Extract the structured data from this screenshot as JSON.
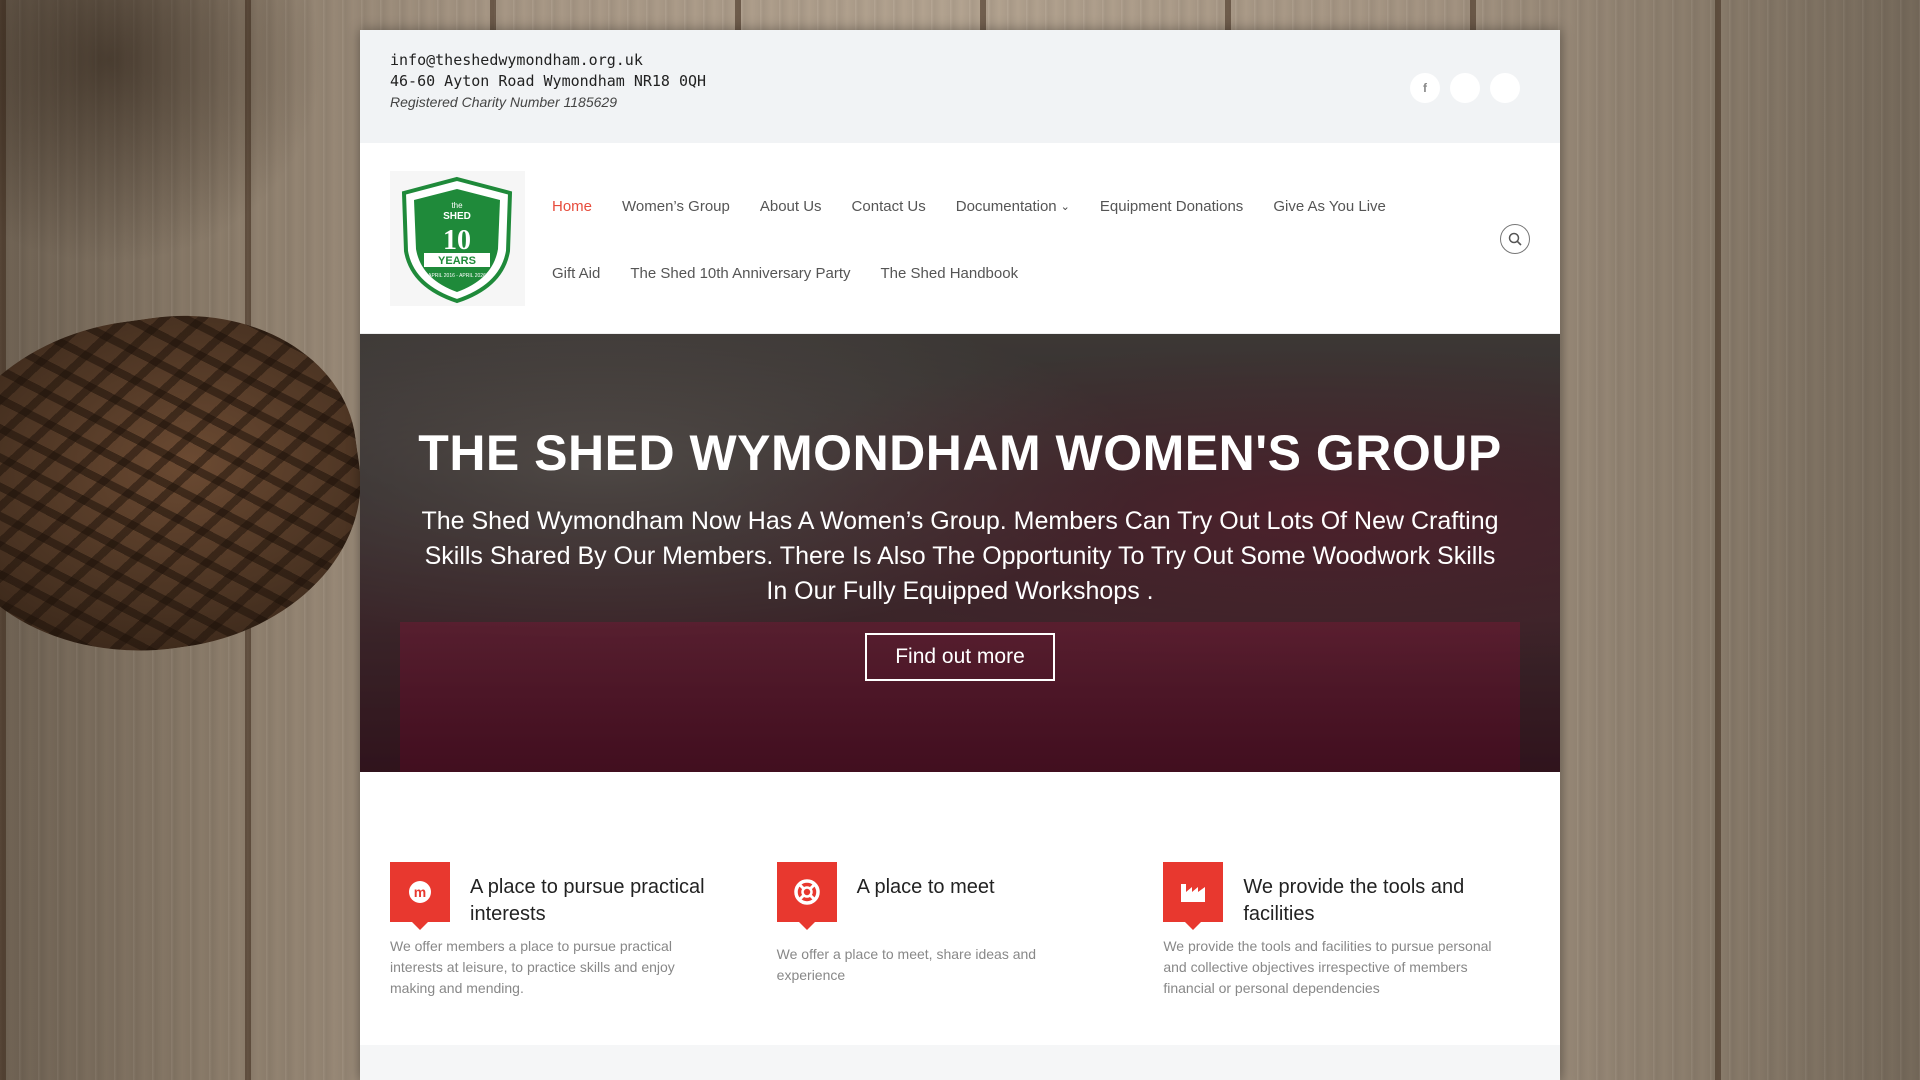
{
  "topbar": {
    "email": "info@theshedwymondham.org.uk",
    "address": "46-60 Ayton Road Wymondham NR18 0QH",
    "charity": "Registered Charity Number 1185629",
    "social_icons": [
      "facebook-icon",
      "social-icon-2",
      "social-icon-3"
    ],
    "facebook_glyph": "f"
  },
  "logo": {
    "line1": "the",
    "line2": "SHED",
    "number": "10",
    "years": "YEARS",
    "dates": "APRIL 2016 - APRIL 2026",
    "color": "#1f8a3a"
  },
  "nav": {
    "row1": [
      "Home",
      "Women’s Group",
      "About Us",
      "Contact Us",
      "Documentation",
      "Equipment Donations",
      "Give As You Live"
    ],
    "row2": [
      "Gift Aid",
      "The Shed 10th Anniversary Party",
      "The Shed Handbook"
    ],
    "active": "Home",
    "dropdown_caret": "⌄"
  },
  "hero": {
    "title": "THE SHED WYMONDHAM WOMEN'S GROUP",
    "text": "The Shed Wymondham Now Has A Women’s Group. Members Can Try Out Lots Of New Crafting Skills Shared By Our Members. There Is Also The Opportunity To Try Out Some Woodwork Skills In Our Fully Equipped Workshops .",
    "button": "Find out more"
  },
  "features": [
    {
      "icon": "meetup-icon",
      "title": "A place to pursue practical interests",
      "desc": "We offer members a place to pursue practical interests at leisure, to practice skills and enjoy making and mending."
    },
    {
      "icon": "lifebuoy-icon",
      "title": "A place to meet",
      "desc": "We offer a place to meet, share ideas and experience"
    },
    {
      "icon": "industry-icon",
      "title": "We provide the tools and facilities",
      "desc": "We provide the tools and facilities to pursue personal and collective objectives irrespective of members financial or personal dependencies"
    }
  ],
  "colors": {
    "accent": "#e8382f",
    "nav_active": "#e74c3c"
  }
}
